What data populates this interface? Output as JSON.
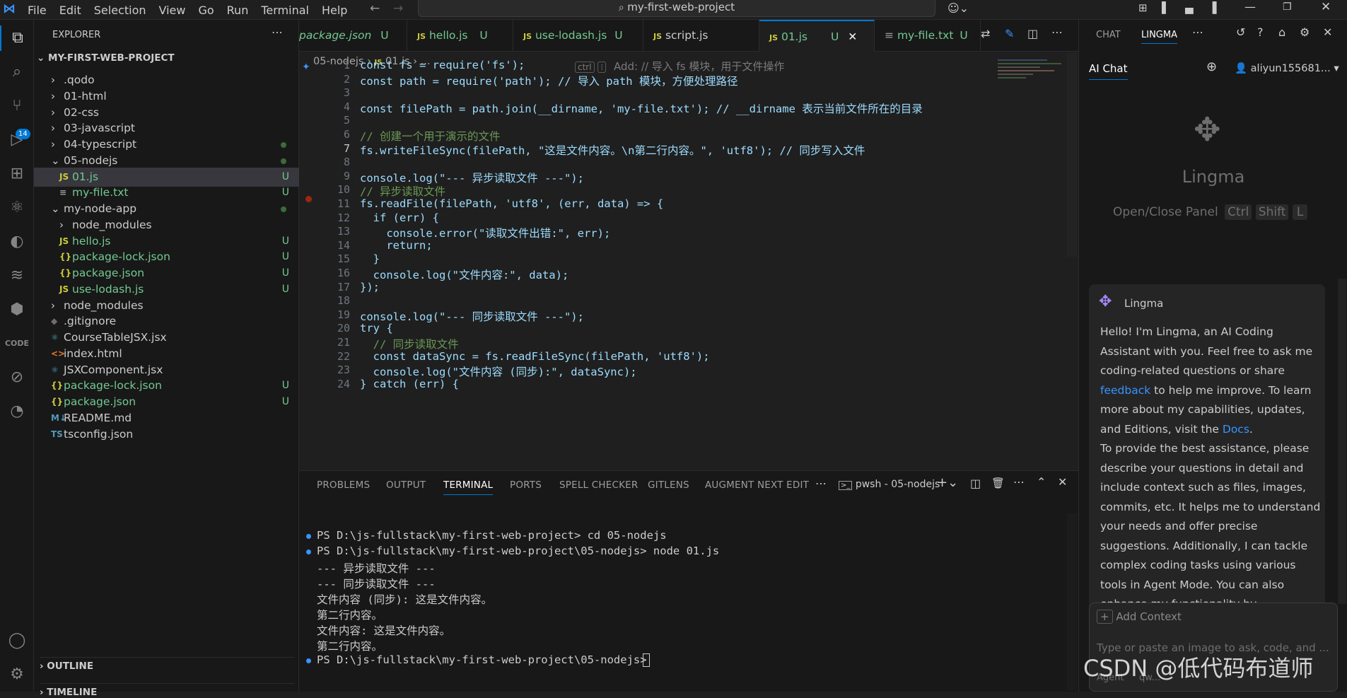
{
  "menu": [
    "File",
    "Edit",
    "Selection",
    "View",
    "Go",
    "Run",
    "Terminal",
    "Help"
  ],
  "search": {
    "label": "my-first-web-project"
  },
  "activity": {
    "source_control_badge": "14"
  },
  "explorer": {
    "title": "EXPLORER",
    "project": "MY-FIRST-WEB-PROJECT",
    "items": [
      {
        "label": ".qodo",
        "kind": "folder",
        "status": ""
      },
      {
        "label": "01-html",
        "kind": "folder",
        "status": ""
      },
      {
        "label": "02-css",
        "kind": "folder",
        "status": ""
      },
      {
        "label": "03-javascript",
        "kind": "folder",
        "status": ""
      },
      {
        "label": "04-typescript",
        "kind": "folder",
        "status": ""
      },
      {
        "label": "05-nodejs",
        "kind": "folder-open",
        "status": ""
      },
      {
        "label": "01.js",
        "kind": "js",
        "status": "U"
      },
      {
        "label": "my-file.txt",
        "kind": "txt",
        "status": "U"
      },
      {
        "label": "my-node-app",
        "kind": "folder-open",
        "status": ""
      },
      {
        "label": "node_modules",
        "kind": "folder",
        "status": ""
      },
      {
        "label": "hello.js",
        "kind": "js",
        "status": "U"
      },
      {
        "label": "package-lock.json",
        "kind": "json",
        "status": "U"
      },
      {
        "label": "package.json",
        "kind": "json",
        "status": "U"
      },
      {
        "label": "use-lodash.js",
        "kind": "js",
        "status": "U"
      },
      {
        "label": "node_modules",
        "kind": "folder",
        "status": ""
      },
      {
        "label": ".gitignore",
        "kind": "git",
        "status": ""
      },
      {
        "label": "CourseTableJSX.jsx",
        "kind": "jsx",
        "status": ""
      },
      {
        "label": "index.html",
        "kind": "html",
        "status": ""
      },
      {
        "label": "JSXComponent.jsx",
        "kind": "jsx",
        "status": ""
      },
      {
        "label": "package-lock.json",
        "kind": "json",
        "status": "U"
      },
      {
        "label": "package.json",
        "kind": "json",
        "status": "U"
      },
      {
        "label": "README.md",
        "kind": "md",
        "status": ""
      },
      {
        "label": "tsconfig.json",
        "kind": "ts",
        "status": ""
      }
    ],
    "outline": "OUTLINE",
    "timeline": "TIMELINE"
  },
  "tabs": [
    {
      "label": "package.json",
      "status": "U",
      "icon": "{}"
    },
    {
      "label": "hello.js",
      "status": "U",
      "icon": "JS"
    },
    {
      "label": "use-lodash.js",
      "status": "U",
      "icon": "JS"
    },
    {
      "label": "script.js",
      "status": "",
      "icon": "JS"
    },
    {
      "label": "01.js",
      "status": "U",
      "icon": "JS"
    },
    {
      "label": "my-file.txt",
      "status": "U",
      "icon": "≡"
    }
  ],
  "breadcrumb": {
    "folder": "05-nodejs",
    "file": "01.js",
    "tail": "..."
  },
  "inline_hint": {
    "key1": "ctrl",
    "text": "Add: // 导入 fs 模块，用于文件操作"
  },
  "code_lines": [
    "const fs = require('fs');",
    "const path = require('path'); // 导入 path 模块，方便处理路径",
    "",
    "const filePath = path.join(__dirname, 'my-file.txt'); // __dirname 表示当前文件所在的目录",
    "",
    "// 创建一个用于演示的文件",
    "fs.writeFileSync(filePath, \"这是文件内容。\\n第二行内容。\", 'utf8'); // 同步写入文件",
    "",
    "console.log(\"--- 异步读取文件 ---\");",
    "// 异步读取文件",
    "fs.readFile(filePath, 'utf8', (err, data) => {",
    "  if (err) {",
    "    console.error(\"读取文件出错:\", err);",
    "    return;",
    "  }",
    "  console.log(\"文件内容:\", data);",
    "});",
    "",
    "console.log(\"--- 同步读取文件 ---\");",
    "try {",
    "  // 同步读取文件",
    "  const dataSync = fs.readFileSync(filePath, 'utf8');",
    "  console.log(\"文件内容 (同步):\", dataSync);",
    "} catch (err) {"
  ],
  "panel": {
    "tabs": [
      "PROBLEMS",
      "OUTPUT",
      "TERMINAL",
      "PORTS",
      "SPELL CHECKER",
      "GITLENS",
      "AUGMENT NEXT EDIT"
    ],
    "active": "TERMINAL",
    "terminal_name": "pwsh - 05-nodejs",
    "lines": [
      "PS D:\\js-fullstack\\my-first-web-project> cd 05-nodejs",
      "PS D:\\js-fullstack\\my-first-web-project\\05-nodejs> node 01.js",
      "--- 异步读取文件 ---",
      "--- 同步读取文件 ---",
      "文件内容 (同步): 这是文件内容。",
      "第二行内容。",
      "文件内容: 这是文件内容。",
      "第二行内容。",
      "PS D:\\js-fullstack\\my-first-web-project\\05-nodejs> "
    ]
  },
  "chat": {
    "tabs": [
      "CHAT",
      "LINGMA"
    ],
    "active_tab": "LINGMA",
    "subtab": "AI Chat",
    "user": "aliyun155681...",
    "brand": "Lingma",
    "shortcut_label": "Open/Close Panel",
    "keys": [
      "Ctrl",
      "Shift",
      "L"
    ],
    "card_title": "Lingma",
    "message_p1_a": "Hello! I'm Lingma, an AI Coding Assistant with you. Feel free to ask me coding-related questions or share ",
    "message_link1": "feedback",
    "message_p1_b": " to help me improve. To learn more about my capabilities, updates, and Editions, visit the ",
    "message_link2": "Docs",
    "message_p1_c": ".",
    "message_p2": "To provide the best assistance, please describe your questions in detail and include context such as files, images, commits, etc. It helps me to understand your needs and offer precise suggestions. Additionally, I can tackle complex coding tasks using various tools in Agent Mode. You can also enhance my functionality by",
    "add_context": "Add Context",
    "input_placeholder": "Type or paste an image to ask, code, and ...",
    "footer_left": "Agent",
    "footer_mid": "qw..."
  },
  "watermark": "CSDN @低代码布道师"
}
